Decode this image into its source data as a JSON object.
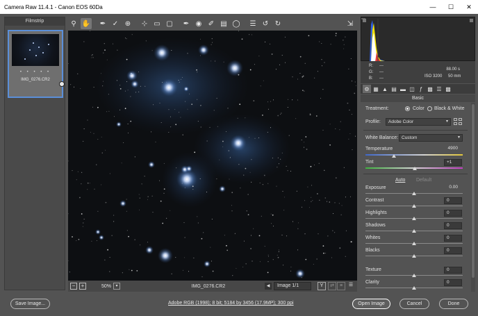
{
  "window": {
    "title": "Camera Raw 11.4.1  -  Canon EOS 60Da",
    "controls": [
      "—",
      "☐",
      "✕"
    ]
  },
  "filmstrip": {
    "header": "Filmstrip",
    "items": [
      {
        "filename": "IMG_0276.CR2",
        "rating_dots": "• • • • •",
        "selected": true
      }
    ]
  },
  "toolbar": {
    "tools": [
      "zoom-icon",
      "hand-icon",
      "white-balance-icon",
      "color-sampler-icon",
      "targeted-adjust-icon",
      "crop-icon",
      "straighten-icon",
      "transform-icon",
      "spot-removal-icon",
      "red-eye-icon",
      "adjustment-brush-icon",
      "graduated-filter-icon",
      "radial-filter-icon",
      "preferences-icon",
      "rotate-left-icon",
      "rotate-right-icon"
    ],
    "active_tool": "hand-icon"
  },
  "canvas_footer": {
    "zoom": "50%",
    "filename": "IMG_0276.CR2",
    "image_counter": "Image 1/1"
  },
  "histogram_info": {
    "r_label": "R:",
    "g_label": "G:",
    "b_label": "B:",
    "r_value": "---",
    "g_value": "---",
    "b_value": "---",
    "shutter": "88.00 s",
    "iso": "ISO 3200",
    "focal": "50 mm"
  },
  "basic_panel": {
    "title": "Basic",
    "treatment_label": "Treatment:",
    "treatment_color": "Color",
    "treatment_bw": "Black & White",
    "treatment_selected": "Color",
    "profile_label": "Profile:",
    "profile_value": "Adobe Color",
    "wb_label": "White Balance:",
    "wb_value": "Custom",
    "temperature_label": "Temperature",
    "temperature_value": "4900",
    "temperature_level": 0.29,
    "tint_label": "Tint",
    "tint_value": "+1",
    "tint_level": 0.51,
    "auto_label": "Auto",
    "default_label": "Default",
    "sliders": [
      {
        "label": "Exposure",
        "value": "0.00",
        "level": 0.5
      },
      {
        "label": "Contrast",
        "value": "0",
        "level": 0.5
      },
      {
        "label": "Highlights",
        "value": "0",
        "level": 0.5
      },
      {
        "label": "Shadows",
        "value": "0",
        "level": 0.5
      },
      {
        "label": "Whites",
        "value": "0",
        "level": 0.5
      },
      {
        "label": "Blacks",
        "value": "0",
        "level": 0.5
      },
      {
        "label": "Texture",
        "value": "0",
        "level": 0.5
      },
      {
        "label": "Clarity",
        "value": "0",
        "level": 0.5
      }
    ]
  },
  "bottom_bar": {
    "save_label": "Save Image...",
    "workflow_link": "Adobe RGB (1998); 8 bit; 5184 by 3456 (17.9MP); 300 ppi",
    "open_label": "Open Image",
    "cancel_label": "Cancel",
    "done_label": "Done"
  },
  "colors": {
    "accent": "#5b8fd9",
    "panel_bg": "#535353",
    "star_glow": "#8fb8ff"
  }
}
